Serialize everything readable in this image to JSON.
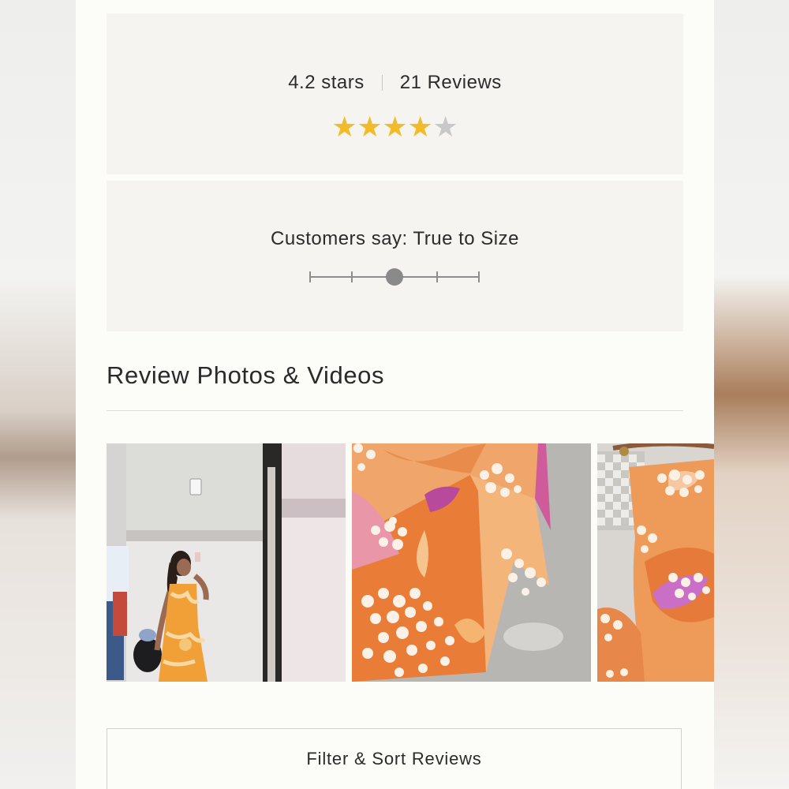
{
  "rating": {
    "stars_text": "4.2 stars",
    "reviews_text": "21 Reviews",
    "value": 4.2,
    "max": 5,
    "star_color": "#f2bb2b",
    "empty_star_color": "#c8c8c8"
  },
  "fit": {
    "label": "Customers say: True to Size",
    "position": 3,
    "steps": 5
  },
  "review_media": {
    "title": "Review Photos & Videos",
    "photos": [
      {
        "name": "review-photo-mirror-selfie",
        "icon": "photo-dress-mirror"
      },
      {
        "name": "review-photo-fabric-closeup",
        "icon": "photo-fabric"
      },
      {
        "name": "review-photo-fabric-bag",
        "icon": "photo-fabric-bag"
      }
    ]
  },
  "filter": {
    "label": "Filter & Sort Reviews"
  }
}
